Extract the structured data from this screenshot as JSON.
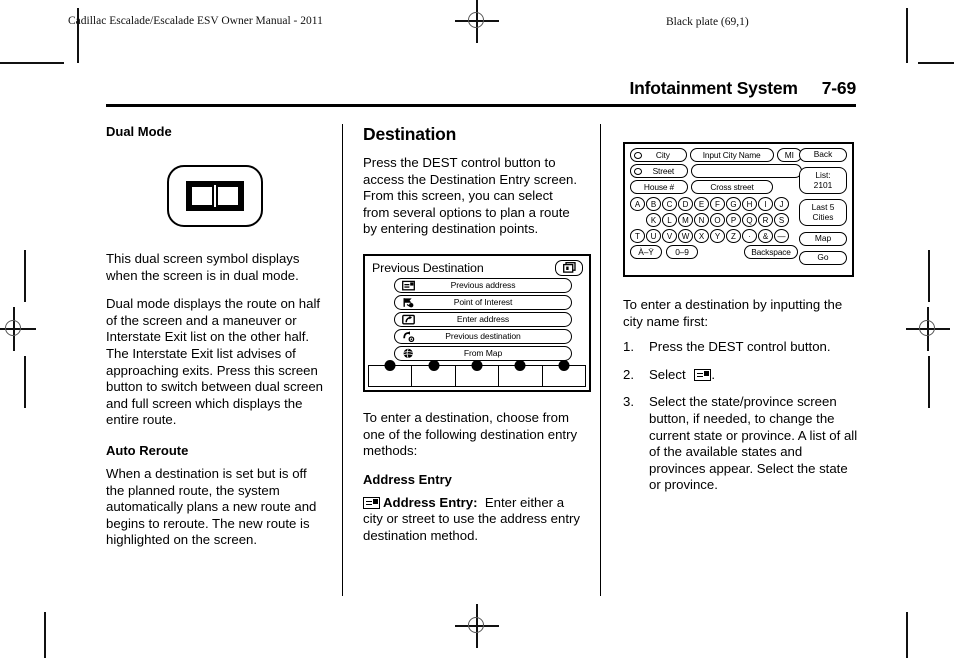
{
  "page": {
    "slug_left": "Cadillac Escalade/Escalade ESV Owner Manual - 2011",
    "slug_right": "Black plate (69,1)",
    "running_head_title": "Infotainment System",
    "running_head_page": "7-69"
  },
  "column_left": {
    "heading": "Dual Mode",
    "symbol_caption": "This dual screen symbol displays when the screen is in dual mode.",
    "paragraph": "Dual mode displays the route on half of the screen and a maneuver or Interstate Exit list on the other half. The Interstate Exit list advises of approaching exits. Press this screen button to switch between dual screen and full screen which displays the entire route.",
    "heading2": "Auto Reroute",
    "paragraph2": "When a destination is set but is off the planned route, the system automatically plans a new route and begins to reroute. The new route is highlighted on the screen."
  },
  "column_middle": {
    "heading": "Destination",
    "intro": "Press the DEST control button to access the Destination Entry screen. From this screen, you can select from several options to plan a route by entering destination points.",
    "figure": {
      "title": "Previous Destination",
      "dual_icon": "dual-screen-icon",
      "menu_items": [
        {
          "label": "Previous address",
          "icon": "address-entry-icon"
        },
        {
          "label": "Point of Interest",
          "icon": "point-of-interest-icon"
        },
        {
          "label": "Enter address",
          "icon": "enter-address-icon"
        },
        {
          "label": "Previous destination",
          "icon": "previous-destination-icon"
        },
        {
          "label": "From Map",
          "icon": "from-map-icon"
        }
      ],
      "tab_count": 5
    },
    "after_figure": "To enter a destination, choose from one of the following destination entry methods:",
    "subheading": "Address Entry",
    "address_entry_bold": "Address Entry:",
    "address_entry_text": "Enter either a city or street to use the address entry destination method."
  },
  "column_right": {
    "figure": {
      "radio_buttons": [
        {
          "label": "City"
        },
        {
          "label": "Street"
        }
      ],
      "house_button": "House #",
      "cross_street_button": "Cross street",
      "input_city_field": "Input City Name",
      "input_street_field": "",
      "state_button": "MI",
      "back_button": "Back",
      "list_button_line1": "List:",
      "list_button_line2": "2101",
      "last_cities_line1": "Last 5",
      "last_cities_line2": "Cities",
      "map_button": "Map",
      "go_button": "Go",
      "backspace_button": "Backspace",
      "accent_button": "À–Ÿ",
      "numeric_button": "0–9",
      "keys_row1": [
        "A",
        "B",
        "C",
        "D",
        "E",
        "F",
        "G",
        "H",
        "I",
        "J"
      ],
      "keys_row2": [
        "K",
        "L",
        "M",
        "N",
        "O",
        "P",
        "Q",
        "R",
        "S"
      ],
      "keys_row3": [
        "T",
        "U",
        "V",
        "W",
        "X",
        "Y",
        "Z",
        "·",
        "&",
        "—"
      ]
    },
    "intro": "To enter a destination by inputting the city name first:",
    "steps": [
      {
        "num": "1.",
        "text": "Press the DEST control button."
      },
      {
        "num": "2.",
        "text": "Select"
      },
      {
        "num": "3.",
        "text": "Select the state/province screen button, if needed, to change the current state or province. A list of all of the available states and provinces appear. Select the state or province."
      }
    ]
  }
}
